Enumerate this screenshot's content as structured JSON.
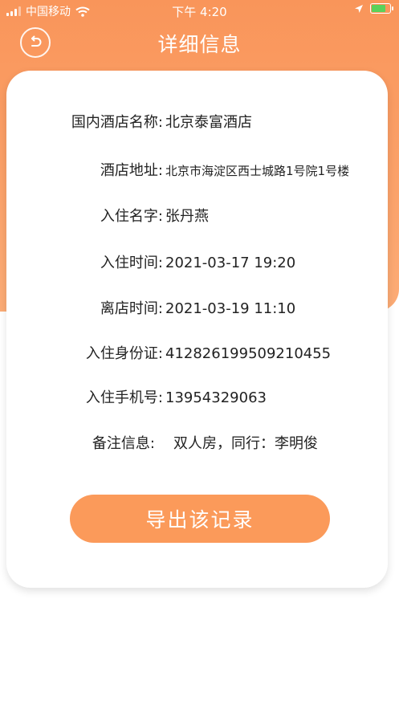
{
  "status_bar": {
    "carrier": "中国移动",
    "time": "下午 4:20"
  },
  "header": {
    "title": "详细信息",
    "back_icon": "back-undo-icon"
  },
  "details": {
    "hotel_name": {
      "label": "国内酒店名称:",
      "value": "北京泰富酒店"
    },
    "hotel_address": {
      "label": "酒店地址:",
      "value": "北京市海淀区西士城路1号院1号楼"
    },
    "guest_name": {
      "label": "入住名字:",
      "value": "张丹燕"
    },
    "check_in": {
      "label": "入住时间:",
      "value": "2021-03-17 19:20"
    },
    "check_out": {
      "label": "离店时间:",
      "value": "2021-03-19 11:10"
    },
    "id_card": {
      "label": "入住身份证:",
      "value": "412826199509210455"
    },
    "phone": {
      "label": "入住手机号:",
      "value": "13954329063"
    },
    "remark": {
      "label": "备注信息:",
      "value": "双人房，同行：李明俊"
    }
  },
  "actions": {
    "export_label": "导出该记录"
  },
  "colors": {
    "accent": "#fb9a5a",
    "header_top": "#f9955a",
    "battery": "#5ad15a"
  }
}
